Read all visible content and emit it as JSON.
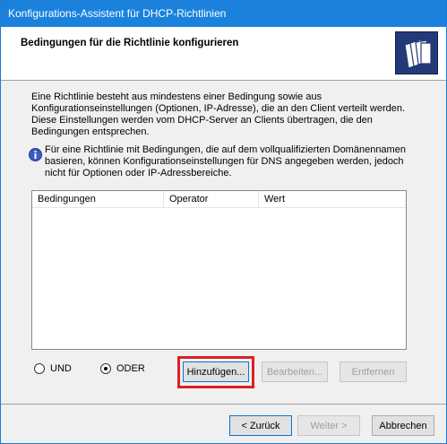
{
  "window": {
    "title": "Konfigurations-Assistent für DHCP-Richtlinien"
  },
  "header": {
    "title": "Bedingungen für die Richtlinie konfigurieren",
    "icon": "folder-stack-icon"
  },
  "description": {
    "line1": "Eine Richtlinie besteht aus mindestens einer Bedingung sowie aus",
    "line2": "Konfigurationseinstellungen (Optionen, IP-Adresse), die an den Client verteilt werden.",
    "line3": "Diese Einstellungen werden vom DHCP-Server an Clients übertragen, die den",
    "line4": "Bedingungen entsprechen."
  },
  "info": {
    "icon": "info-icon",
    "line1": "Für eine Richtlinie mit Bedingungen, die auf dem vollqualifizierten Domänennamen",
    "line2": "basieren, können Konfigurationseinstellungen für DNS angegeben werden, jedoch",
    "line3": "nicht für Optionen oder IP-Adressbereiche."
  },
  "conditions_list": {
    "columns": [
      "Bedingungen",
      "Operator",
      "Wert"
    ],
    "rows": []
  },
  "logic": {
    "and_label": "UND",
    "or_label": "ODER",
    "selected": "ODER"
  },
  "actions": {
    "add_label": "Hinzufügen...",
    "edit_label": "Bearbeiten...",
    "remove_label": "Entfernen"
  },
  "footer": {
    "back_label": "< Zurück",
    "next_label": "Weiter >",
    "cancel_label": "Abbrechen"
  },
  "colors": {
    "titlebar": "#1a82dd",
    "highlight": "#e02020",
    "header_icon_bg": "#233a78"
  }
}
